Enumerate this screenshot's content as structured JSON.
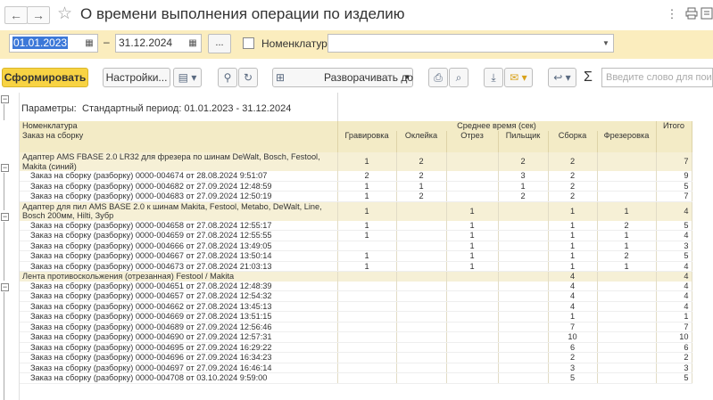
{
  "window": {
    "title": "О времени выполнения операции по изделию",
    "nav_back": "←",
    "nav_forward": "→",
    "favorite": "☆"
  },
  "params": {
    "date_from": "01.01.2023",
    "date_to": "31.12.2024",
    "dash": "–",
    "dots_label": "...",
    "nomenclature_label": "Номенклатура:",
    "nomenclature_value": ""
  },
  "toolbar": {
    "generate_label": "Сформировать",
    "settings_label": "Настройки...",
    "expand_label": "Разворачивать до",
    "search_placeholder": "Введите слово для поиска",
    "sigma": "Σ"
  },
  "report": {
    "params_caption": "Параметры:",
    "params_value": "Стандартный период: 01.01.2023 - 31.12.2024",
    "header_nomenclature": "Номенклатура",
    "header_order": "Заказ на сборку",
    "header_avg_time": "Среднее время (сек)",
    "header_total": "Итого",
    "operations": [
      "Гравировка",
      "Оклейка",
      "Отрез",
      "Пильщик",
      "Сборка",
      "Фрезеровка"
    ],
    "rows": [
      {
        "kind": "group",
        "name": "Адаптер AMS FBASE 2.0 LR32 для фрезера по шинам DeWalt, Bosch, Festool, Makita (синий)",
        "v": [
          "1",
          "2",
          "",
          "2",
          "2",
          ""
        ],
        "total": "7"
      },
      {
        "kind": "det",
        "name": "Заказ на сборку (разборку) 0000-004674 от 28.08.2024 9:51:07",
        "v": [
          "2",
          "2",
          "",
          "3",
          "2",
          ""
        ],
        "total": "9"
      },
      {
        "kind": "det",
        "name": "Заказ на сборку (разборку) 0000-004682 от 27.09.2024 12:48:59",
        "v": [
          "1",
          "1",
          "",
          "1",
          "2",
          ""
        ],
        "total": "5"
      },
      {
        "kind": "det",
        "name": "Заказ на сборку (разборку) 0000-004683 от 27.09.2024 12:50:19",
        "v": [
          "1",
          "2",
          "",
          "2",
          "2",
          ""
        ],
        "total": "7"
      },
      {
        "kind": "group",
        "name": "Адаптер для пил AMS BASE 2.0 к шинам Makita, Festool, Metabo, DeWalt, Line, Bosch 200мм, Hilti, Зубр",
        "v": [
          "1",
          "",
          "1",
          "",
          "1",
          "1"
        ],
        "total": "4"
      },
      {
        "kind": "det",
        "name": "Заказ на сборку (разборку) 0000-004658 от 27.08.2024 12:55:17",
        "v": [
          "1",
          "",
          "1",
          "",
          "1",
          "2"
        ],
        "total": "5"
      },
      {
        "kind": "det",
        "name": "Заказ на сборку (разборку) 0000-004659 от 27.08.2024 12:55:55",
        "v": [
          "1",
          "",
          "1",
          "",
          "1",
          "1"
        ],
        "total": "4"
      },
      {
        "kind": "det",
        "name": "Заказ на сборку (разборку) 0000-004666 от 27.08.2024 13:49:05",
        "v": [
          "",
          "",
          "1",
          "",
          "1",
          "1"
        ],
        "total": "3"
      },
      {
        "kind": "det",
        "name": "Заказ на сборку (разборку) 0000-004667 от 27.08.2024 13:50:14",
        "v": [
          "1",
          "",
          "1",
          "",
          "1",
          "2"
        ],
        "total": "5"
      },
      {
        "kind": "det",
        "name": "Заказ на сборку (разборку) 0000-004673 от 27.08.2024 21:03:13",
        "v": [
          "1",
          "",
          "1",
          "",
          "1",
          "1"
        ],
        "total": "4"
      },
      {
        "kind": "group1",
        "name": "Лента противоскольжения (отрезанная) Festool / Makita",
        "v": [
          "",
          "",
          "",
          "",
          "4",
          ""
        ],
        "total": "4"
      },
      {
        "kind": "det",
        "name": "Заказ на сборку (разборку) 0000-004651 от 27.08.2024 12:48:39",
        "v": [
          "",
          "",
          "",
          "",
          "4",
          ""
        ],
        "total": "4"
      },
      {
        "kind": "det",
        "name": "Заказ на сборку (разборку) 0000-004657 от 27.08.2024 12:54:32",
        "v": [
          "",
          "",
          "",
          "",
          "4",
          ""
        ],
        "total": "4"
      },
      {
        "kind": "det",
        "name": "Заказ на сборку (разборку) 0000-004662 от 27.08.2024 13:45:13",
        "v": [
          "",
          "",
          "",
          "",
          "4",
          ""
        ],
        "total": "4"
      },
      {
        "kind": "det",
        "name": "Заказ на сборку (разборку) 0000-004669 от 27.08.2024 13:51:15",
        "v": [
          "",
          "",
          "",
          "",
          "1",
          ""
        ],
        "total": "1"
      },
      {
        "kind": "det",
        "name": "Заказ на сборку (разборку) 0000-004689 от 27.09.2024 12:56:46",
        "v": [
          "",
          "",
          "",
          "",
          "7",
          ""
        ],
        "total": "7"
      },
      {
        "kind": "det",
        "name": "Заказ на сборку (разборку) 0000-004690 от 27.09.2024 12:57:31",
        "v": [
          "",
          "",
          "",
          "",
          "10",
          ""
        ],
        "total": "10"
      },
      {
        "kind": "det",
        "name": "Заказ на сборку (разборку) 0000-004695 от 27.09.2024 16:29:22",
        "v": [
          "",
          "",
          "",
          "",
          "6",
          ""
        ],
        "total": "6"
      },
      {
        "kind": "det",
        "name": "Заказ на сборку (разборку) 0000-004696 от 27.09.2024 16:34:23",
        "v": [
          "",
          "",
          "",
          "",
          "2",
          ""
        ],
        "total": "2"
      },
      {
        "kind": "det",
        "name": "Заказ на сборку (разборку) 0000-004697 от 27.09.2024 16:46:14",
        "v": [
          "",
          "",
          "",
          "",
          "3",
          ""
        ],
        "total": "3"
      },
      {
        "kind": "det",
        "name": "Заказ на сборку (разборку) 0000-004708 от 03.10.2024 9:59:00",
        "v": [
          "",
          "",
          "",
          "",
          "5",
          ""
        ],
        "total": "5"
      }
    ]
  },
  "colors": {
    "param_bar": "#fbedbe",
    "primary_button": "#f8d343",
    "header_bg": "#f3ebc6",
    "group_bg": "#f6f0d6",
    "date_selection": "#3c78d8"
  },
  "icons": [
    "arrow-left-icon",
    "arrow-right-icon",
    "star-icon",
    "more-icon",
    "print-icon",
    "link-icon",
    "close-icon",
    "calendar-icon",
    "dropdown-icon",
    "variant-icon",
    "search-icon",
    "clear-search-icon",
    "print-icon",
    "preview-icon",
    "save-icon",
    "email-icon",
    "back-arrow-icon",
    "sigma-icon"
  ]
}
